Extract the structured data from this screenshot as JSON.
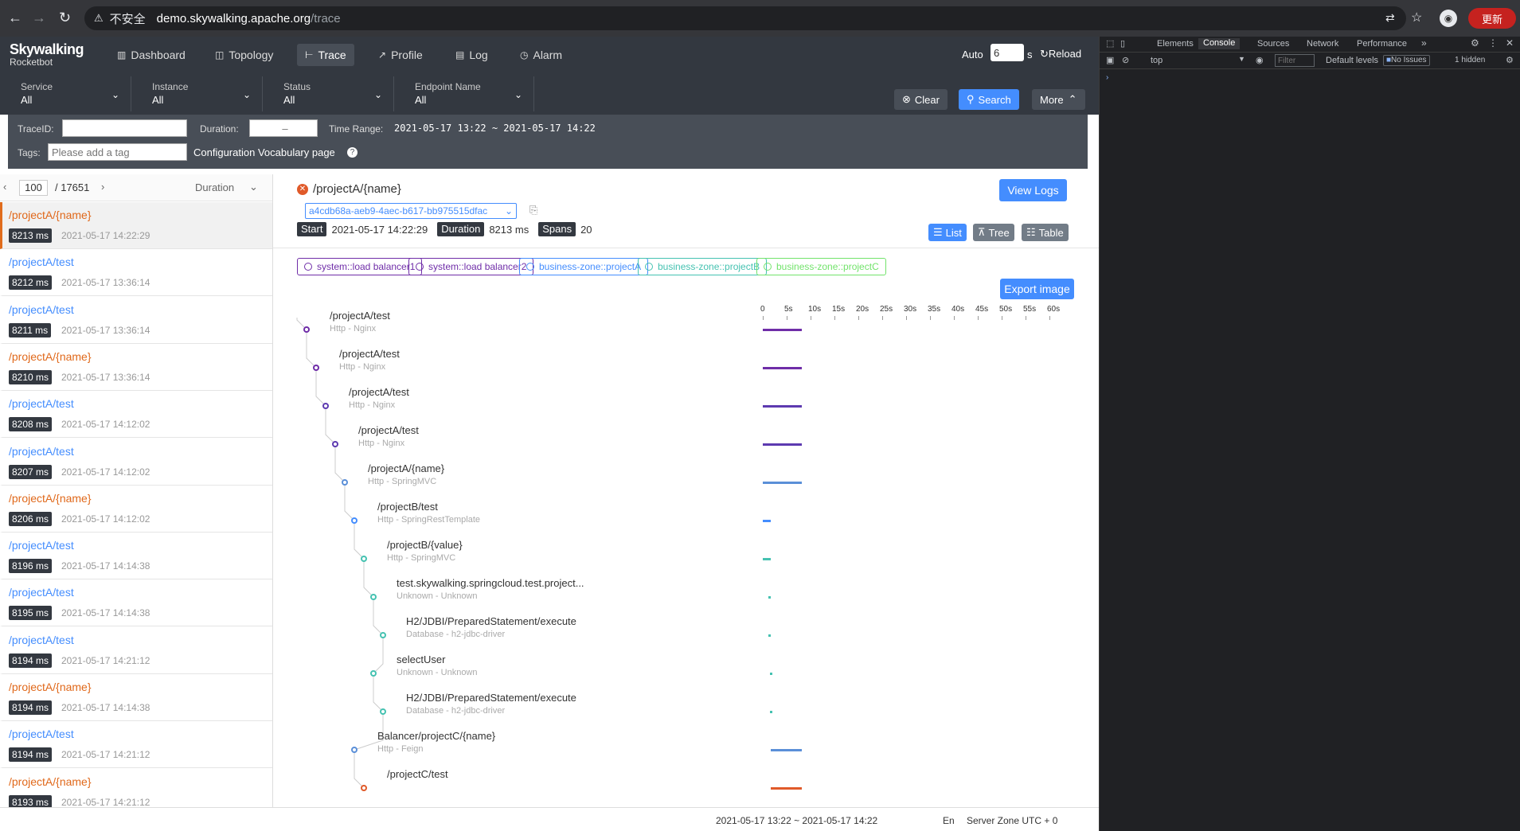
{
  "browser": {
    "insecure_label": "不安全",
    "url_host": "demo.skywalking.apache.org",
    "url_path": "/trace",
    "update_label": "更新"
  },
  "app": {
    "logo": "Skywalking",
    "logo_sub": "Rocketbot",
    "nav": [
      {
        "label": "Dashboard",
        "icon": "dashboard-icon"
      },
      {
        "label": "Topology",
        "icon": "topology-icon"
      },
      {
        "label": "Trace",
        "icon": "trace-icon"
      },
      {
        "label": "Profile",
        "icon": "profile-icon"
      },
      {
        "label": "Log",
        "icon": "log-icon"
      },
      {
        "label": "Alarm",
        "icon": "alarm-icon"
      }
    ],
    "auto_label": "Auto",
    "auto_value": "6",
    "auto_unit": "s",
    "reload_label": "Reload"
  },
  "filters": {
    "service": {
      "label": "Service",
      "value": "All"
    },
    "instance": {
      "label": "Instance",
      "value": "All"
    },
    "status": {
      "label": "Status",
      "value": "All"
    },
    "endpoint": {
      "label": "Endpoint Name",
      "value": "All"
    },
    "clear_label": "Clear",
    "search_label": "Search",
    "more_label": "More",
    "traceid_label": "TraceID:",
    "duration_label": "Duration:",
    "duration_placeholder": "–",
    "time_range_label": "Time Range:",
    "time_range_value": "2021-05-17 13:22 ~ 2021-05-17 14:22",
    "tags_label": "Tags:",
    "tags_placeholder": "Please add a tag",
    "vocab_label": "Configuration Vocabulary page"
  },
  "list": {
    "page": "100",
    "total": "/ 17651",
    "sort_label": "Duration",
    "items": [
      {
        "endpoint": "/projectA/{name}",
        "duration": "8213 ms",
        "time": "2021-05-17 14:22:29",
        "error": true
      },
      {
        "endpoint": "/projectA/test",
        "duration": "8212 ms",
        "time": "2021-05-17 13:36:14",
        "error": false
      },
      {
        "endpoint": "/projectA/test",
        "duration": "8211 ms",
        "time": "2021-05-17 13:36:14",
        "error": false
      },
      {
        "endpoint": "/projectA/{name}",
        "duration": "8210 ms",
        "time": "2021-05-17 13:36:14",
        "error": true
      },
      {
        "endpoint": "/projectA/test",
        "duration": "8208 ms",
        "time": "2021-05-17 14:12:02",
        "error": false
      },
      {
        "endpoint": "/projectA/test",
        "duration": "8207 ms",
        "time": "2021-05-17 14:12:02",
        "error": false
      },
      {
        "endpoint": "/projectA/{name}",
        "duration": "8206 ms",
        "time": "2021-05-17 14:12:02",
        "error": true
      },
      {
        "endpoint": "/projectA/test",
        "duration": "8196 ms",
        "time": "2021-05-17 14:14:38",
        "error": false
      },
      {
        "endpoint": "/projectA/test",
        "duration": "8195 ms",
        "time": "2021-05-17 14:14:38",
        "error": false
      },
      {
        "endpoint": "/projectA/test",
        "duration": "8194 ms",
        "time": "2021-05-17 14:21:12",
        "error": false
      },
      {
        "endpoint": "/projectA/{name}",
        "duration": "8194 ms",
        "time": "2021-05-17 14:14:38",
        "error": true
      },
      {
        "endpoint": "/projectA/test",
        "duration": "8194 ms",
        "time": "2021-05-17 14:21:12",
        "error": false
      },
      {
        "endpoint": "/projectA/{name}",
        "duration": "8193 ms",
        "time": "2021-05-17 14:21:12",
        "error": true
      }
    ]
  },
  "detail": {
    "title": "/projectA/{name}",
    "view_logs": "View Logs",
    "trace_id": "a4cdb68a-aeb9-4aec-b617-bb975515dfac",
    "start_label": "Start",
    "start_value": "2021-05-17 14:22:29",
    "duration_label": "Duration",
    "duration_value": "8213 ms",
    "spans_label": "Spans",
    "spans_value": "20",
    "view_list": "List",
    "view_tree": "Tree",
    "view_table": "Table",
    "export_label": "Export image",
    "services": [
      {
        "name": "system::load balancer1",
        "color": "#6f2da8"
      },
      {
        "name": "system::load balancer2",
        "color": "#6f2da8"
      },
      {
        "name": "business-zone::projectA",
        "color": "#448dfe"
      },
      {
        "name": "business-zone::projectB",
        "color": "#45c2b1"
      },
      {
        "name": "business-zone::projectC",
        "color": "#72e36b"
      }
    ],
    "axis_ticks": [
      "0",
      "5s",
      "10s",
      "15s",
      "20s",
      "25s",
      "30s",
      "35s",
      "40s",
      "45s",
      "50s",
      "55s",
      "60s"
    ],
    "spans": [
      {
        "name": "/projectA/test",
        "sub": "Http - Nginx",
        "color": "#6f2da8",
        "start": 0,
        "len": 8.2
      },
      {
        "name": "/projectA/test",
        "sub": "Http - Nginx",
        "color": "#6f2da8",
        "start": 0,
        "len": 8.2
      },
      {
        "name": "/projectA/test",
        "sub": "Http - Nginx",
        "color": "#5d3ab0",
        "start": 0,
        "len": 8.2
      },
      {
        "name": "/projectA/test",
        "sub": "Http - Nginx",
        "color": "#5d3ab0",
        "start": 0,
        "len": 8.2
      },
      {
        "name": "/projectA/{name}",
        "sub": "Http - SpringMVC",
        "color": "#5a8fd8",
        "start": 0,
        "len": 8.2
      },
      {
        "name": "/projectB/test",
        "sub": "Http - SpringRestTemplate",
        "color": "#448dfe",
        "start": 0,
        "len": 1.6
      },
      {
        "name": "/projectB/{value}",
        "sub": "Http - SpringMVC",
        "color": "#45c2b1",
        "start": 0,
        "len": 1.6
      },
      {
        "name": "test.skywalking.springcloud.test.project...",
        "sub": "Unknown - Unknown",
        "color": "#45c2b1",
        "start": 1.1,
        "len": 0.4
      },
      {
        "name": "H2/JDBI/PreparedStatement/execute",
        "sub": "Database - h2-jdbc-driver",
        "color": "#45c2b1",
        "start": 1.1,
        "len": 0.4
      },
      {
        "name": "selectUser",
        "sub": "Unknown - Unknown",
        "color": "#45c2b1",
        "start": 1.5,
        "len": 0.2
      },
      {
        "name": "H2/JDBI/PreparedStatement/execute",
        "sub": "Database - h2-jdbc-driver",
        "color": "#45c2b1",
        "start": 1.5,
        "len": 0.2
      },
      {
        "name": "Balancer/projectC/{name}",
        "sub": "Http - Feign",
        "color": "#5a8fd8",
        "start": 1.6,
        "len": 6.6
      },
      {
        "name": "/projectC/test",
        "sub": "",
        "color": "#e05a2a",
        "start": 1.6,
        "len": 6.6
      }
    ]
  },
  "status": {
    "range": "2021-05-17 13:22 ~ 2021-05-17 14:22",
    "lang": "En",
    "zone": "Server Zone UTC + 0"
  },
  "devtools": {
    "tabs": [
      "Elements",
      "Console",
      "Sources",
      "Network",
      "Performance"
    ],
    "context": "top",
    "filter_placeholder": "Filter",
    "levels": "Default levels",
    "issues": "No Issues",
    "hidden": "1 hidden"
  }
}
